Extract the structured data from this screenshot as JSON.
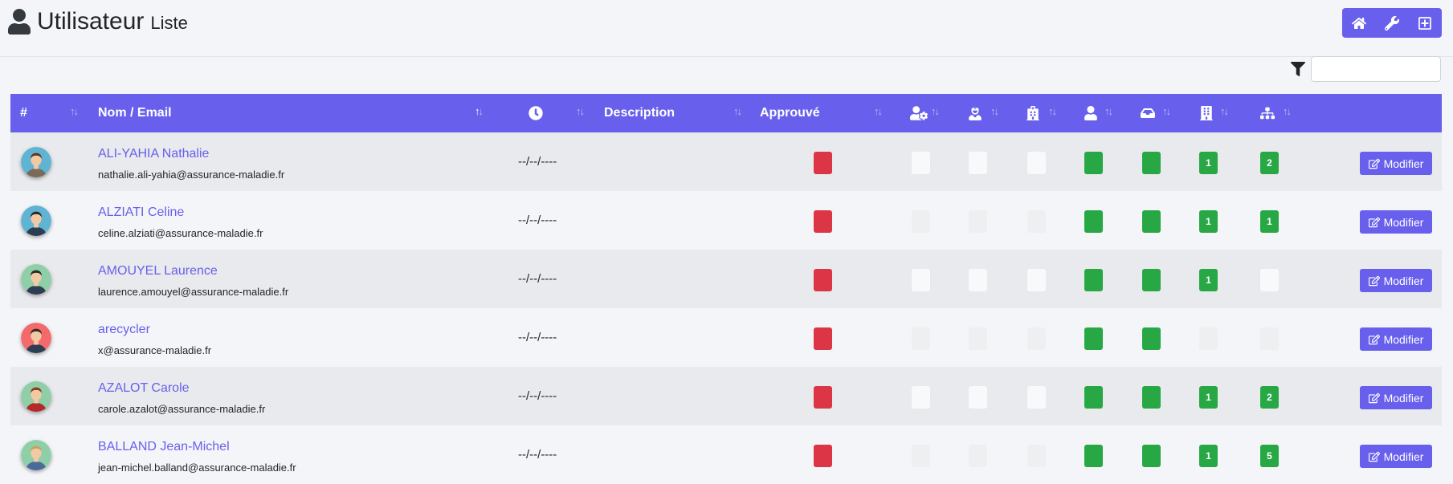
{
  "header": {
    "title": "Utilisateur",
    "subtitle": "Liste",
    "title_icon": "user-icon",
    "buttons": [
      {
        "icon": "home-icon"
      },
      {
        "icon": "wrench-icon"
      },
      {
        "icon": "plus-square-icon"
      }
    ]
  },
  "filter": {
    "icon": "filter-icon",
    "value": "",
    "placeholder": ""
  },
  "table": {
    "columns": [
      {
        "label": "#",
        "sort": "both"
      },
      {
        "label": "Nom / Email",
        "sort": "asc"
      },
      {
        "label": "",
        "icon": "clock-icon",
        "sort": "both"
      },
      {
        "label": "Description",
        "sort": "both"
      },
      {
        "label": "Approuvé",
        "sort": "both"
      },
      {
        "label": "",
        "icon": "user-cog-icon",
        "sort": "both"
      },
      {
        "label": "",
        "icon": "user-nurse-icon",
        "sort": "both"
      },
      {
        "label": "",
        "icon": "hospital-icon",
        "sort": "both"
      },
      {
        "label": "",
        "icon": "user-icon",
        "sort": "both"
      },
      {
        "label": "",
        "icon": "inbox-icon",
        "sort": "both"
      },
      {
        "label": "",
        "icon": "building-icon",
        "sort": "both"
      },
      {
        "label": "",
        "icon": "sitemap-icon",
        "sort": "both"
      }
    ],
    "rows": [
      {
        "avatar": {
          "bg": "#5fb3d3",
          "hair": "#5a3825",
          "shirt": "#7a6a58",
          "skin": "#f1c9a5"
        },
        "name": "ALI-YAHIA Nathalie",
        "email": "nathalie.ali-yahia@assurance-maladie.fr",
        "date": "--/--/----",
        "approved": "red",
        "flags": [
          "grey",
          "grey",
          "grey",
          "green",
          "green",
          "1",
          "2"
        ]
      },
      {
        "avatar": {
          "bg": "#5fb3d3",
          "hair": "#2b2b2b",
          "shirt": "#2e3e52",
          "skin": "#f1c9a5"
        },
        "name": "ALZIATI Celine",
        "email": "celine.alziati@assurance-maladie.fr",
        "date": "--/--/----",
        "approved": "red",
        "flags": [
          "faint",
          "faint",
          "faint",
          "green",
          "green",
          "1",
          "1"
        ]
      },
      {
        "avatar": {
          "bg": "#8fcfa8",
          "hair": "#2b2b2b",
          "shirt": "#2e3e52",
          "skin": "#f1c9a5"
        },
        "name": "AMOUYEL Laurence",
        "email": "laurence.amouyel@assurance-maladie.fr",
        "date": "--/--/----",
        "approved": "red",
        "flags": [
          "grey",
          "grey",
          "grey",
          "green",
          "green",
          "1",
          "grey"
        ]
      },
      {
        "avatar": {
          "bg": "#f46a6a",
          "hair": "#3a2a22",
          "shirt": "#2e3e52",
          "skin": "#f1c9a5"
        },
        "name": "arecycler",
        "email": "x@assurance-maladie.fr",
        "date": "--/--/----",
        "approved": "red",
        "flags": [
          "faint",
          "faint",
          "faint",
          "green",
          "green",
          "faint",
          "faint"
        ]
      },
      {
        "avatar": {
          "bg": "#8fcfa8",
          "hair": "#8b3a1e",
          "shirt": "#b22a2a",
          "skin": "#f1c9a5"
        },
        "name": "AZALOT Carole",
        "email": "carole.azalot@assurance-maladie.fr",
        "date": "--/--/----",
        "approved": "red",
        "flags": [
          "grey",
          "grey",
          "grey",
          "green",
          "green",
          "1",
          "2"
        ]
      },
      {
        "avatar": {
          "bg": "#8fcfa8",
          "hair": "#c9a25a",
          "shirt": "#4a6a9a",
          "skin": "#f1c9a5"
        },
        "name": "BALLAND Jean-Michel",
        "email": "jean-michel.balland@assurance-maladie.fr",
        "date": "--/--/----",
        "approved": "red",
        "flags": [
          "faint",
          "faint",
          "faint",
          "green",
          "green",
          "1",
          "5"
        ]
      }
    ],
    "action_label": "Modifier",
    "action_icon": "edit-icon"
  },
  "colors": {
    "primary": "#6860ec",
    "danger": "#dc3545",
    "success": "#28a745"
  }
}
